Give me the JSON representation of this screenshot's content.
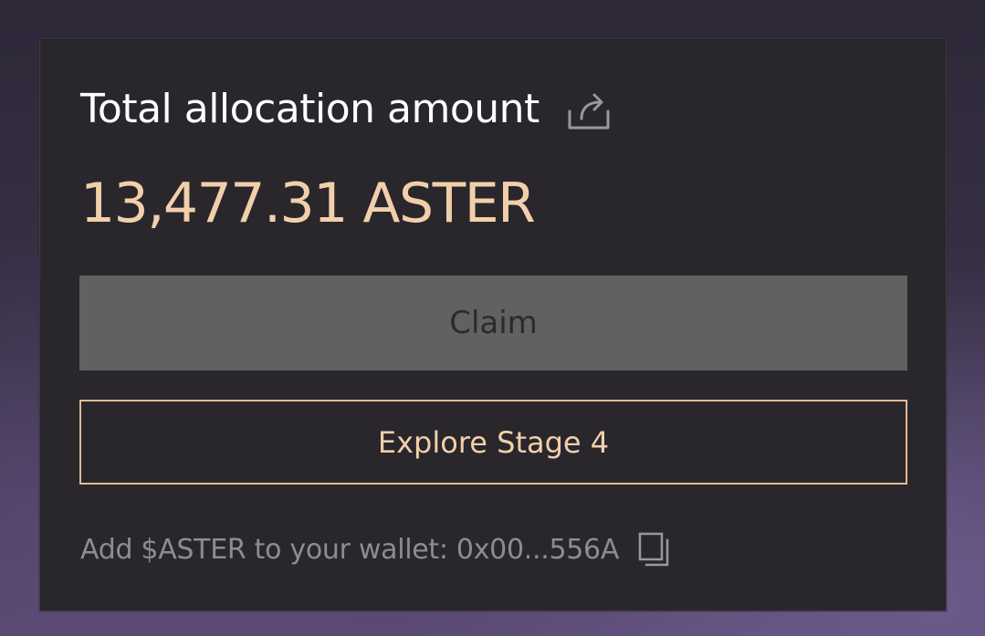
{
  "card": {
    "title": "Total allocation amount",
    "share_icon": "share-icon",
    "amount": "13,477.31 ASTER",
    "claim_label": "Claim",
    "explore_label": "Explore Stage 4",
    "wallet_text": "Add $ASTER to your wallet: 0x00...556A",
    "copy_icon": "copy-icon"
  },
  "colors": {
    "card_bg": "#29272c",
    "accent": "#f2cfab",
    "accent_border": "#e6b98f",
    "claim_bg": "#616161",
    "muted_text": "#8e8c92"
  }
}
